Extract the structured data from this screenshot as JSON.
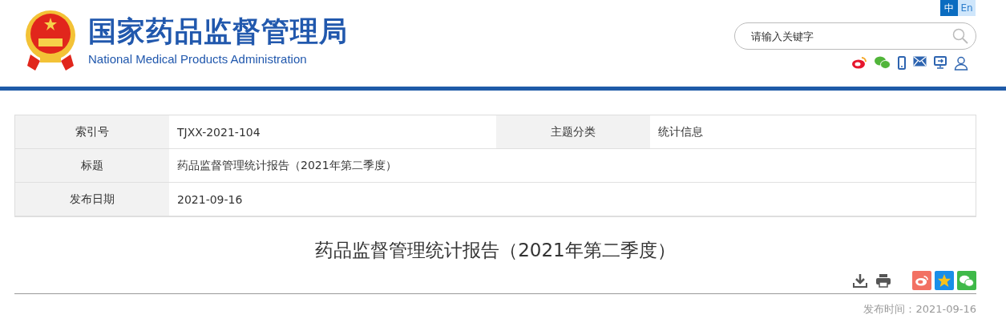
{
  "header": {
    "title": "国家药品监督管理局",
    "subtitle": "National Medical Products Administration",
    "languages": [
      {
        "label": "中",
        "selected": true
      },
      {
        "label": "En",
        "selected": false
      }
    ],
    "search": {
      "placeholder": "请输入关键字"
    },
    "links": [
      {
        "kind": "weibo"
      },
      {
        "kind": "wechat"
      },
      {
        "kind": "phone"
      },
      {
        "kind": "mail"
      },
      {
        "kind": "screen"
      },
      {
        "kind": "user"
      }
    ]
  },
  "info_table": {
    "rows": [
      [
        {
          "label": "索引号",
          "value": "TJXX-2021-104"
        },
        {
          "label": "主题分类",
          "value": "统计信息"
        }
      ],
      [
        {
          "label": "标题",
          "value": "药品监督管理统计报告（2021年第二季度）"
        }
      ],
      [
        {
          "label": "发布日期",
          "value": "2021-09-16"
        }
      ]
    ]
  },
  "article": {
    "title": "药品监督管理统计报告（2021年第二季度）",
    "tools": [
      {
        "kind": "download"
      },
      {
        "kind": "print"
      }
    ],
    "share": [
      {
        "kind": "weibo"
      },
      {
        "kind": "qzone"
      },
      {
        "kind": "wechat"
      }
    ],
    "published": "发布时间：2021-09-16"
  }
}
